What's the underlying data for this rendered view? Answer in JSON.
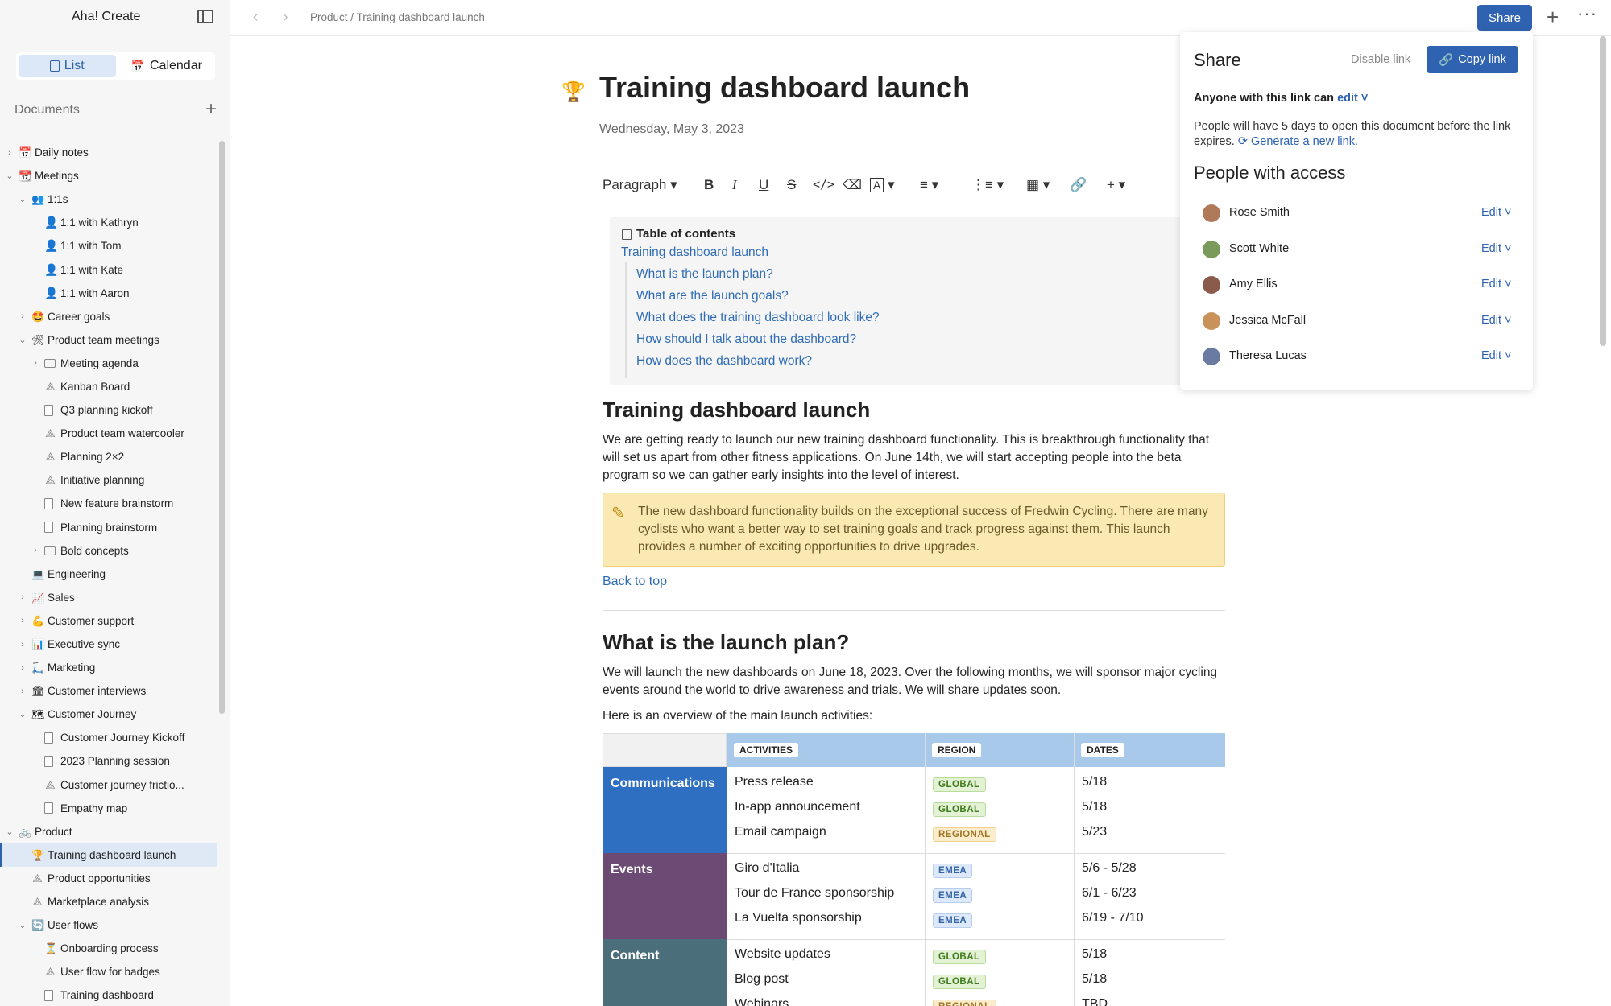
{
  "app": {
    "title": "Aha! Create"
  },
  "sidebar": {
    "view_tabs": [
      {
        "label": "List",
        "active": true
      },
      {
        "label": "Calendar",
        "active": false
      }
    ],
    "documents_label": "Documents",
    "tree": [
      {
        "label": "Daily notes",
        "depth": 0,
        "chevron": "right",
        "icon": "calendar"
      },
      {
        "label": "Meetings",
        "depth": 0,
        "chevron": "down",
        "icon": "calendar-red"
      },
      {
        "label": "1:1s",
        "depth": 1,
        "chevron": "down",
        "icon": "people"
      },
      {
        "label": "1:1 with Kathryn",
        "depth": 2,
        "chevron": "",
        "icon": "person"
      },
      {
        "label": "1:1 with Tom",
        "depth": 2,
        "chevron": "",
        "icon": "person"
      },
      {
        "label": "1:1 with Kate",
        "depth": 2,
        "chevron": "",
        "icon": "person"
      },
      {
        "label": "1:1 with Aaron",
        "depth": 2,
        "chevron": "",
        "icon": "person"
      },
      {
        "label": "Career goals",
        "depth": 1,
        "chevron": "right",
        "icon": "star-face"
      },
      {
        "label": "Product team meetings",
        "depth": 1,
        "chevron": "down",
        "icon": "tools"
      },
      {
        "label": "Meeting agenda",
        "depth": 2,
        "chevron": "right",
        "icon": "folder"
      },
      {
        "label": "Kanban Board",
        "depth": 2,
        "chevron": "",
        "icon": "whiteboard"
      },
      {
        "label": "Q3 planning kickoff",
        "depth": 2,
        "chevron": "",
        "icon": "doc"
      },
      {
        "label": "Product team watercooler",
        "depth": 2,
        "chevron": "",
        "icon": "whiteboard"
      },
      {
        "label": "Planning 2×2",
        "depth": 2,
        "chevron": "",
        "icon": "whiteboard"
      },
      {
        "label": "Initiative planning",
        "depth": 2,
        "chevron": "",
        "icon": "whiteboard"
      },
      {
        "label": "New feature brainstorm",
        "depth": 2,
        "chevron": "",
        "icon": "doc"
      },
      {
        "label": "Planning brainstorm",
        "depth": 2,
        "chevron": "",
        "icon": "doc"
      },
      {
        "label": "Bold concepts",
        "depth": 2,
        "chevron": "right",
        "icon": "folder"
      },
      {
        "label": "Engineering",
        "depth": 1,
        "chevron": "",
        "icon": "computer"
      },
      {
        "label": "Sales",
        "depth": 1,
        "chevron": "right",
        "icon": "chart"
      },
      {
        "label": "Customer support",
        "depth": 1,
        "chevron": "right",
        "icon": "muscle"
      },
      {
        "label": "Executive sync",
        "depth": 1,
        "chevron": "right",
        "icon": "bar-chart"
      },
      {
        "label": "Marketing",
        "depth": 1,
        "chevron": "right",
        "icon": "scooter"
      },
      {
        "label": "Customer interviews",
        "depth": 1,
        "chevron": "right",
        "icon": "building"
      },
      {
        "label": "Customer Journey",
        "depth": 1,
        "chevron": "down",
        "icon": "map"
      },
      {
        "label": "Customer Journey Kickoff",
        "depth": 2,
        "chevron": "",
        "icon": "doc"
      },
      {
        "label": "2023 Planning session",
        "depth": 2,
        "chevron": "",
        "icon": "doc"
      },
      {
        "label": "Customer journey frictio...",
        "depth": 2,
        "chevron": "",
        "icon": "whiteboard"
      },
      {
        "label": "Empathy map",
        "depth": 2,
        "chevron": "",
        "icon": "doc"
      },
      {
        "label": "Product",
        "depth": 0,
        "chevron": "down",
        "icon": "bike"
      },
      {
        "label": "Training dashboard launch",
        "depth": 1,
        "chevron": "",
        "icon": "trophy",
        "selected": true
      },
      {
        "label": "Product opportunities",
        "depth": 1,
        "chevron": "",
        "icon": "whiteboard"
      },
      {
        "label": "Marketplace analysis",
        "depth": 1,
        "chevron": "",
        "icon": "whiteboard"
      },
      {
        "label": "User flows",
        "depth": 1,
        "chevron": "down",
        "icon": "cycle"
      },
      {
        "label": "Onboarding process",
        "depth": 2,
        "chevron": "",
        "icon": "hourglass"
      },
      {
        "label": "User flow for badges",
        "depth": 2,
        "chevron": "",
        "icon": "whiteboard"
      },
      {
        "label": "Training dashboard",
        "depth": 2,
        "chevron": "",
        "icon": "doc"
      }
    ]
  },
  "topbar": {
    "breadcrumb": "Product / Training dashboard launch",
    "share_label": "Share"
  },
  "document": {
    "title": "Training dashboard launch",
    "date": "Wednesday, May 3, 2023",
    "toolbar": {
      "paragraph_label": "Paragraph"
    },
    "toc": {
      "title": "Table of contents",
      "root": "Training dashboard launch",
      "items": [
        "What is the launch plan?",
        "What are the launch goals?",
        "What does the training dashboard look like?",
        "How should I talk about the dashboard?",
        "How does the dashboard work?"
      ]
    },
    "section1": {
      "heading": "Training dashboard launch",
      "body": "We are getting ready to launch our new training dashboard functionality. This is breakthrough functionality that will set us apart from other fitness applications. On June 14th, we will start accepting people into the beta program so we can gather early insights into the level of interest.",
      "callout": "The new dashboard functionality builds on the exceptional success of Fredwin Cycling. There are many cyclists who want a better way to set training goals and track progress against them. This launch provides a number of exciting opportunities to drive upgrades.",
      "back_to_top": "Back to top"
    },
    "section2": {
      "heading": "What is the launch plan?",
      "body": "We will launch the new dashboards on June 18, 2023. Over the following months, we will sponsor major cycling events around the world to drive awareness and trials. We will share updates soon.",
      "overview": "Here is an overview of the main launch activities:"
    },
    "plan_table": {
      "headers": [
        "ACTIVITIES",
        "REGION",
        "DATES"
      ],
      "groups": [
        {
          "name": "Communications",
          "color": "#2f6fc2",
          "rows": [
            {
              "activity": "Press release",
              "region": "GLOBAL",
              "dates": "5/18"
            },
            {
              "activity": "In-app announcement",
              "region": "GLOBAL",
              "dates": "5/18"
            },
            {
              "activity": "Email campaign",
              "region": "REGIONAL",
              "dates": "5/23"
            }
          ]
        },
        {
          "name": "Events",
          "color": "#6b4a73",
          "rows": [
            {
              "activity": "Giro d'Italia",
              "region": "EMEA",
              "dates": "5/6 - 5/28"
            },
            {
              "activity": "Tour de France sponsorship",
              "region": "EMEA",
              "dates": "6/1 - 6/23"
            },
            {
              "activity": "La Vuelta sponsorship",
              "region": "EMEA",
              "dates": "6/19 - 7/10"
            }
          ]
        },
        {
          "name": "Content",
          "color": "#4a6e7a",
          "rows": [
            {
              "activity": "Website updates",
              "region": "GLOBAL",
              "dates": "5/18"
            },
            {
              "activity": "Blog post",
              "region": "GLOBAL",
              "dates": "5/18"
            },
            {
              "activity": "Webinars",
              "region": "REGIONAL",
              "dates": "TBD"
            }
          ]
        }
      ]
    }
  },
  "share": {
    "title": "Share",
    "disable_link": "Disable link",
    "copy_link": "Copy link",
    "anyone_prefix": "Anyone with this link can",
    "anyone_permission": "edit",
    "note": "People will have 5 days to open this document before the link expires.",
    "regenerate": "Generate a new link.",
    "people_title": "People with access",
    "people": [
      {
        "name": "Rose Smith",
        "role": "Edit",
        "avatar_color": "#b07a5a"
      },
      {
        "name": "Scott White",
        "role": "Edit",
        "avatar_color": "#7a9a5a"
      },
      {
        "name": "Amy Ellis",
        "role": "Edit",
        "avatar_color": "#8a5a4a"
      },
      {
        "name": "Jessica McFall",
        "role": "Edit",
        "avatar_color": "#c9925a"
      },
      {
        "name": "Theresa Lucas",
        "role": "Edit",
        "avatar_color": "#6a7aa0"
      }
    ]
  },
  "colors": {
    "accent": "#2f62b0",
    "link": "#2f6cb5",
    "callout_bg": "#fbe9b3",
    "table_header": "#a8c9ea"
  }
}
